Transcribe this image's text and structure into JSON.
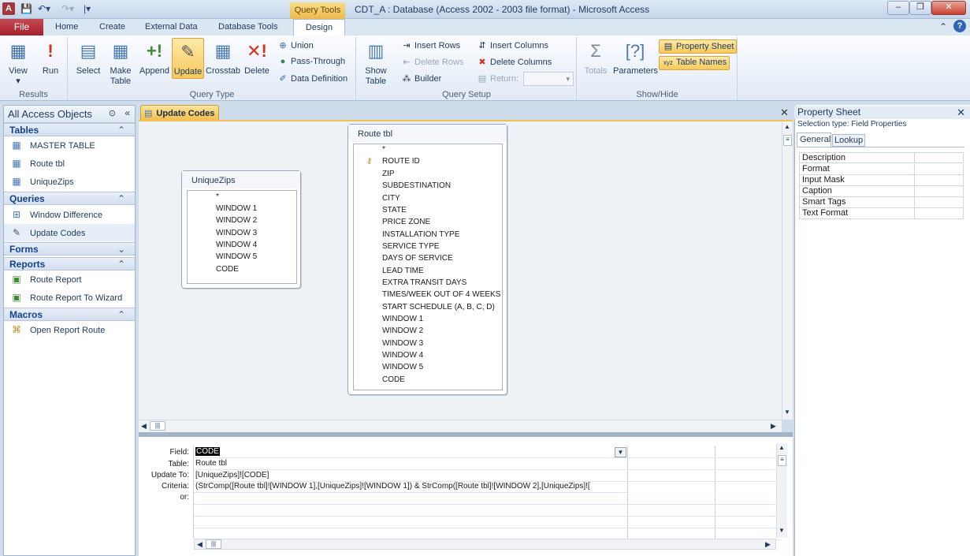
{
  "window": {
    "title": "CDT_A : Database (Access 2002 - 2003 file format)  -  Microsoft Access",
    "contextual_tab_group": "Query Tools",
    "controls": [
      "–",
      "❐",
      "✕"
    ]
  },
  "ribbon": {
    "tabs": [
      "File",
      "Home",
      "Create",
      "External Data",
      "Database Tools",
      "Design"
    ],
    "active_tab": "Design",
    "groups": {
      "results": {
        "label": "Results",
        "view": "View",
        "run": "Run"
      },
      "query_type": {
        "label": "Query Type",
        "select": "Select",
        "make_table_1": "Make",
        "make_table_2": "Table",
        "append": "Append",
        "update": "Update",
        "crosstab": "Crosstab",
        "delete": "Delete",
        "union": "Union",
        "pass_through": "Pass-Through",
        "data_definition": "Data Definition"
      },
      "query_setup": {
        "label": "Query Setup",
        "show_table_1": "Show",
        "show_table_2": "Table",
        "insert_rows": "Insert Rows",
        "delete_rows": "Delete Rows",
        "builder": "Builder",
        "insert_columns": "Insert Columns",
        "delete_columns": "Delete Columns",
        "return": "Return:"
      },
      "show_hide": {
        "label": "Show/Hide",
        "totals": "Totals",
        "parameters": "Parameters",
        "property_sheet": "Property Sheet",
        "table_names": "Table Names"
      }
    }
  },
  "nav": {
    "header": "All Access Objects",
    "sections": [
      {
        "label": "Tables",
        "chevron": "⌃",
        "items": [
          "MASTER TABLE",
          "Route tbl",
          "UniqueZips"
        ]
      },
      {
        "label": "Queries",
        "chevron": "⌃",
        "items": [
          "Window Difference",
          "Update Codes"
        ]
      },
      {
        "label": "Forms",
        "chevron": "⌄",
        "items": []
      },
      {
        "label": "Reports",
        "chevron": "⌃",
        "items": [
          "Route Report",
          "Route Report To Wizard"
        ]
      },
      {
        "label": "Macros",
        "chevron": "⌃",
        "items": [
          "Open Report Route"
        ]
      }
    ]
  },
  "document": {
    "tab_label": "Update Codes",
    "tables": [
      {
        "name": "UniqueZips",
        "fields": [
          "*",
          "WINDOW 1",
          "WINDOW 2",
          "WINDOW 3",
          "WINDOW 4",
          "WINDOW 5",
          "CODE"
        ]
      },
      {
        "name": "Route tbl",
        "key_field": "ROUTE ID",
        "fields": [
          "*",
          "ROUTE ID",
          "ZIP",
          "SUBDESTINATION",
          "CITY",
          "STATE",
          "PRICE ZONE",
          "INSTALLATION TYPE",
          "SERVICE TYPE",
          "DAYS OF SERVICE",
          "LEAD TIME",
          "EXTRA TRANSIT DAYS",
          "TIMES/WEEK OUT OF 4 WEEKS",
          "START SCHEDULE (A, B, C, D)",
          "WINDOW 1",
          "WINDOW 2",
          "WINDOW 3",
          "WINDOW 4",
          "WINDOW 5",
          "CODE"
        ]
      }
    ],
    "grid": {
      "row_labels": [
        "Field:",
        "Table:",
        "Update To:",
        "Criteria:",
        "or:"
      ],
      "column1": {
        "field": "CODE",
        "table": "Route tbl",
        "update_to": "[UniqueZips]![CODE]",
        "criteria": "(StrComp([Route tbl]![WINDOW 1],[UniqueZips]![WINDOW 1]) & StrComp([Route tbl]![WINDOW 2],[UniqueZips]!["
      }
    }
  },
  "property_sheet": {
    "title": "Property Sheet",
    "selection_type": "Selection type:  Field Properties",
    "tabs": [
      "General",
      "Lookup"
    ],
    "active_tab": "General",
    "properties": [
      "Description",
      "Format",
      "Input Mask",
      "Caption",
      "Smart Tags",
      "Text Format"
    ]
  }
}
